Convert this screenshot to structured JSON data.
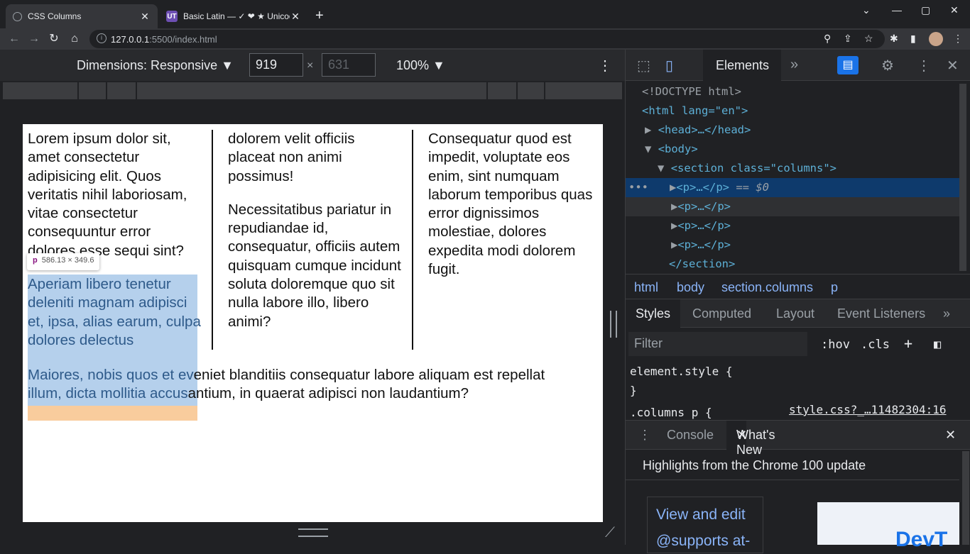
{
  "browser": {
    "tabs": [
      {
        "title": "CSS Columns",
        "active": true
      },
      {
        "title": "Basic Latin — ✓ ❤ ★ Unicode",
        "active": false,
        "favicon": "UT"
      }
    ],
    "new_tab": "+",
    "window_controls": [
      "⌄",
      "—",
      "▢",
      "✕"
    ],
    "url_host": "127.0.0.1",
    "url_rest": ":5500/index.html"
  },
  "device_toolbar": {
    "dimensions_label": "Dimensions: Responsive ▼",
    "width": "919",
    "height": "631",
    "times": "×",
    "zoom": "100% ▼"
  },
  "page": {
    "col1_p1": "Lorem ipsum dolor sit, amet consectetur adipisicing elit. Quos veritatis nihil laboriosam, vitae consectetur consequuntur error dolores esse sequi sint?",
    "col1_p2": "Aperiam libero tenetur deleniti magnam adipisci et, ipsa, alias earum, culpa dolores delectus",
    "col2_p1": "dolorem velit officiis placeat non animi possimus!",
    "col2_p2": "Necessitatibus pariatur in repudiandae id, consequatur, officiis autem quisquam cumque incidunt soluta doloremque quo sit nulla labore illo, libero animi?",
    "col3_p1": "Consequatur quod est impedit, voluptate eos enim, sint numquam laborum temporibus quas error dignissimos molestiae, dolores expedita modi dolorem fugit.",
    "bottom_hl1": "Maiores, nobis quos et ev",
    "bottom_rest1": "eniet blanditiis consequatur labore aliquam est repellat",
    "bottom_hl2": "illum, dicta mollitia accus",
    "bottom_rest2": "antium, in quaerat adipisci non laudantium?",
    "tooltip_tag": "p",
    "tooltip_size": "586.13 × 349.6"
  },
  "devtools": {
    "elements_tab": "Elements",
    "dom": {
      "doctype": "<!DOCTYPE html>",
      "html_open": "<html lang=\"en\">",
      "head": "<head>…</head>",
      "body_open": "<body>",
      "section_open": "<section class=\"columns\">",
      "p_collapsed": "<p>…</p>",
      "selected_suffix": "== $0",
      "section_close": "</section>"
    },
    "breadcrumbs": [
      "html",
      "body",
      "section.columns",
      "p"
    ],
    "subtabs": [
      "Styles",
      "Computed",
      "Layout",
      "Event Listeners",
      "»"
    ],
    "filter_placeholder": "Filter",
    "hov": ":hov",
    "cls": ".cls",
    "element_style": "element.style {",
    "close_brace": "}",
    "rule_selector": ".columns p {",
    "rule_source": "style.css?_…11482304:16",
    "drawer_tabs": [
      "Console",
      "What's New"
    ],
    "whats_new_title": "Highlights from the Chrome 100 update",
    "card_text": "View and edit @supports at-",
    "image_text": "DevT"
  }
}
